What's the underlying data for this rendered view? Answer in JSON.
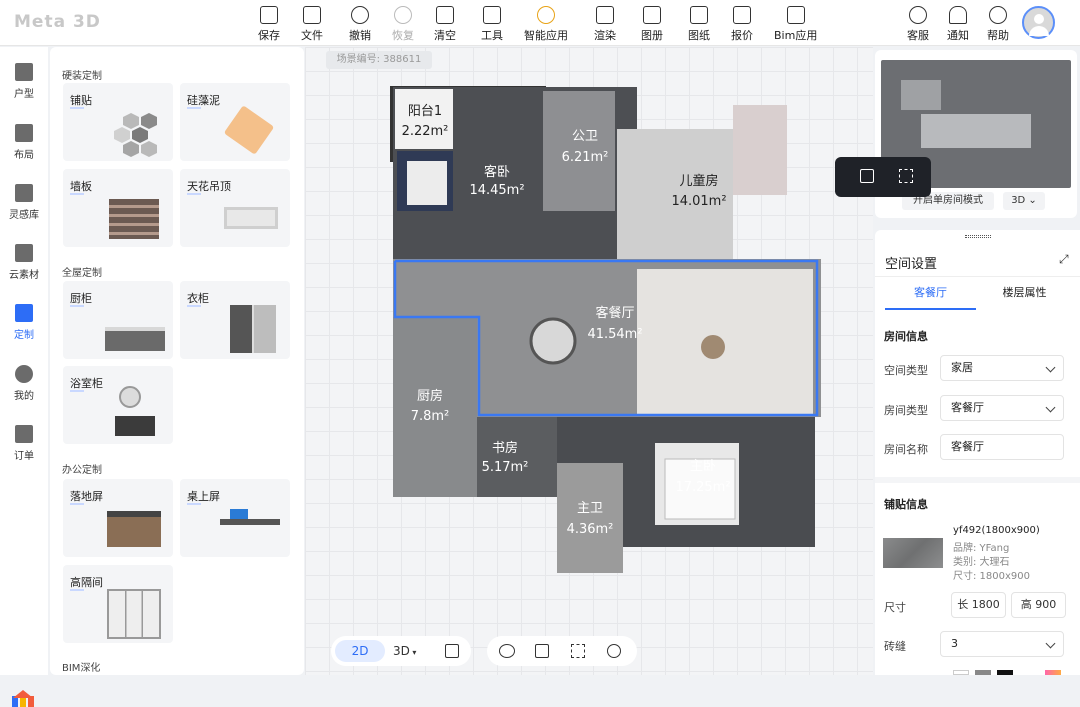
{
  "app": {
    "logo": "Meta 3D"
  },
  "toolbar": [
    {
      "label": "保存",
      "icon": "save-icon"
    },
    {
      "label": "文件",
      "icon": "file-icon"
    },
    {
      "label": "撤销",
      "icon": "undo-icon"
    },
    {
      "label": "恢复",
      "icon": "redo-icon"
    },
    {
      "label": "清空",
      "icon": "trash-icon"
    },
    {
      "label": "工具",
      "icon": "tools-icon"
    },
    {
      "label": "智能应用",
      "icon": "bulb-icon"
    },
    {
      "label": "渲染",
      "icon": "render-icon"
    },
    {
      "label": "图册",
      "icon": "album-icon"
    },
    {
      "label": "图纸",
      "icon": "drawing-icon"
    },
    {
      "label": "报价",
      "icon": "quote-icon"
    },
    {
      "label": "Bim应用",
      "icon": "bim-icon"
    }
  ],
  "toolbar_right": [
    {
      "label": "客服",
      "icon": "headset-icon"
    },
    {
      "label": "通知",
      "icon": "bell-icon"
    },
    {
      "label": "帮助",
      "icon": "help-icon"
    }
  ],
  "leftnav": [
    "户型",
    "布局",
    "灵感库",
    "云素材",
    "定制",
    "我的",
    "订单"
  ],
  "catalog": {
    "sections": [
      "硬装定制",
      "全屋定制",
      "办公定制",
      "BIM深化"
    ],
    "cards": [
      "铺贴",
      "硅藻泥",
      "墙板",
      "天花吊顶",
      "厨柜",
      "衣柜",
      "浴室柜",
      "落地屏",
      "桌上屏",
      "高隔间"
    ]
  },
  "canvas": {
    "scene_id": "场景编号: 388611",
    "rooms": [
      {
        "name": "阳台1",
        "area": "2.22m²"
      },
      {
        "name": "客卧",
        "area": "14.45m²"
      },
      {
        "name": "公卫",
        "area": "6.21m²"
      },
      {
        "name": "儿童房",
        "area": "14.01m²"
      },
      {
        "name": "客餐厅",
        "area": "41.54m²"
      },
      {
        "name": "厨房",
        "area": "7.8m²"
      },
      {
        "name": "书房",
        "area": "5.17m²"
      },
      {
        "name": "主卧",
        "area": "17.25m²"
      },
      {
        "name": "主卫",
        "area": "4.36m²"
      }
    ],
    "view_2d": "2D",
    "view_3d": "3D"
  },
  "minimap": {
    "mode_button": "开启单房间模式",
    "view": "3D"
  },
  "props": {
    "title": "空间设置",
    "tabs": [
      "客餐厅",
      "楼层属性"
    ],
    "room_info_title": "房间信息",
    "space_type_label": "空间类型",
    "space_type": "家居",
    "room_type_label": "房间类型",
    "room_type": "客餐厅",
    "room_name_label": "房间名称",
    "room_name": "客餐厅",
    "tile_info_title": "铺贴信息",
    "tile": {
      "code": "yf492(1800x900)",
      "brand": "品牌: YFang",
      "category": "类别: 大理石",
      "size": "尺寸: 1800x900"
    },
    "size_label": "尺寸",
    "length": "长 1800",
    "height": "高 900",
    "joint_label": "砖缝",
    "joint": "3"
  }
}
